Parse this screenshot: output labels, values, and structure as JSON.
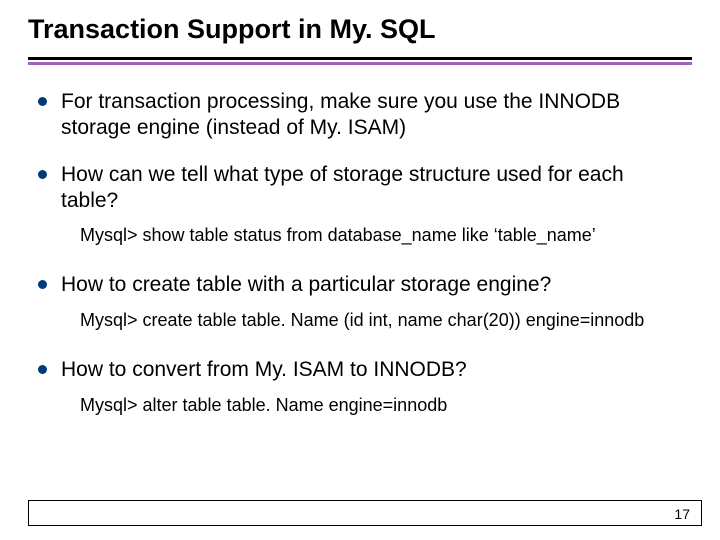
{
  "title": "Transaction Support in My. SQL",
  "bullets": [
    {
      "text": "For transaction processing, make sure you use the INNODB storage engine (instead of My. ISAM)",
      "sub": null
    },
    {
      "text": "How can we tell what type of storage structure used for each table?",
      "sub": "Mysql> show table status from database_name like ‘table_name’"
    },
    {
      "text": "How to create table with a particular storage engine?",
      "sub": "Mysql> create table table. Name (id int, name char(20)) engine=innodb"
    },
    {
      "text": "How to convert from My. ISAM to INNODB?",
      "sub": "Mysql> alter table table. Name engine=innodb"
    }
  ],
  "page_number": "17"
}
